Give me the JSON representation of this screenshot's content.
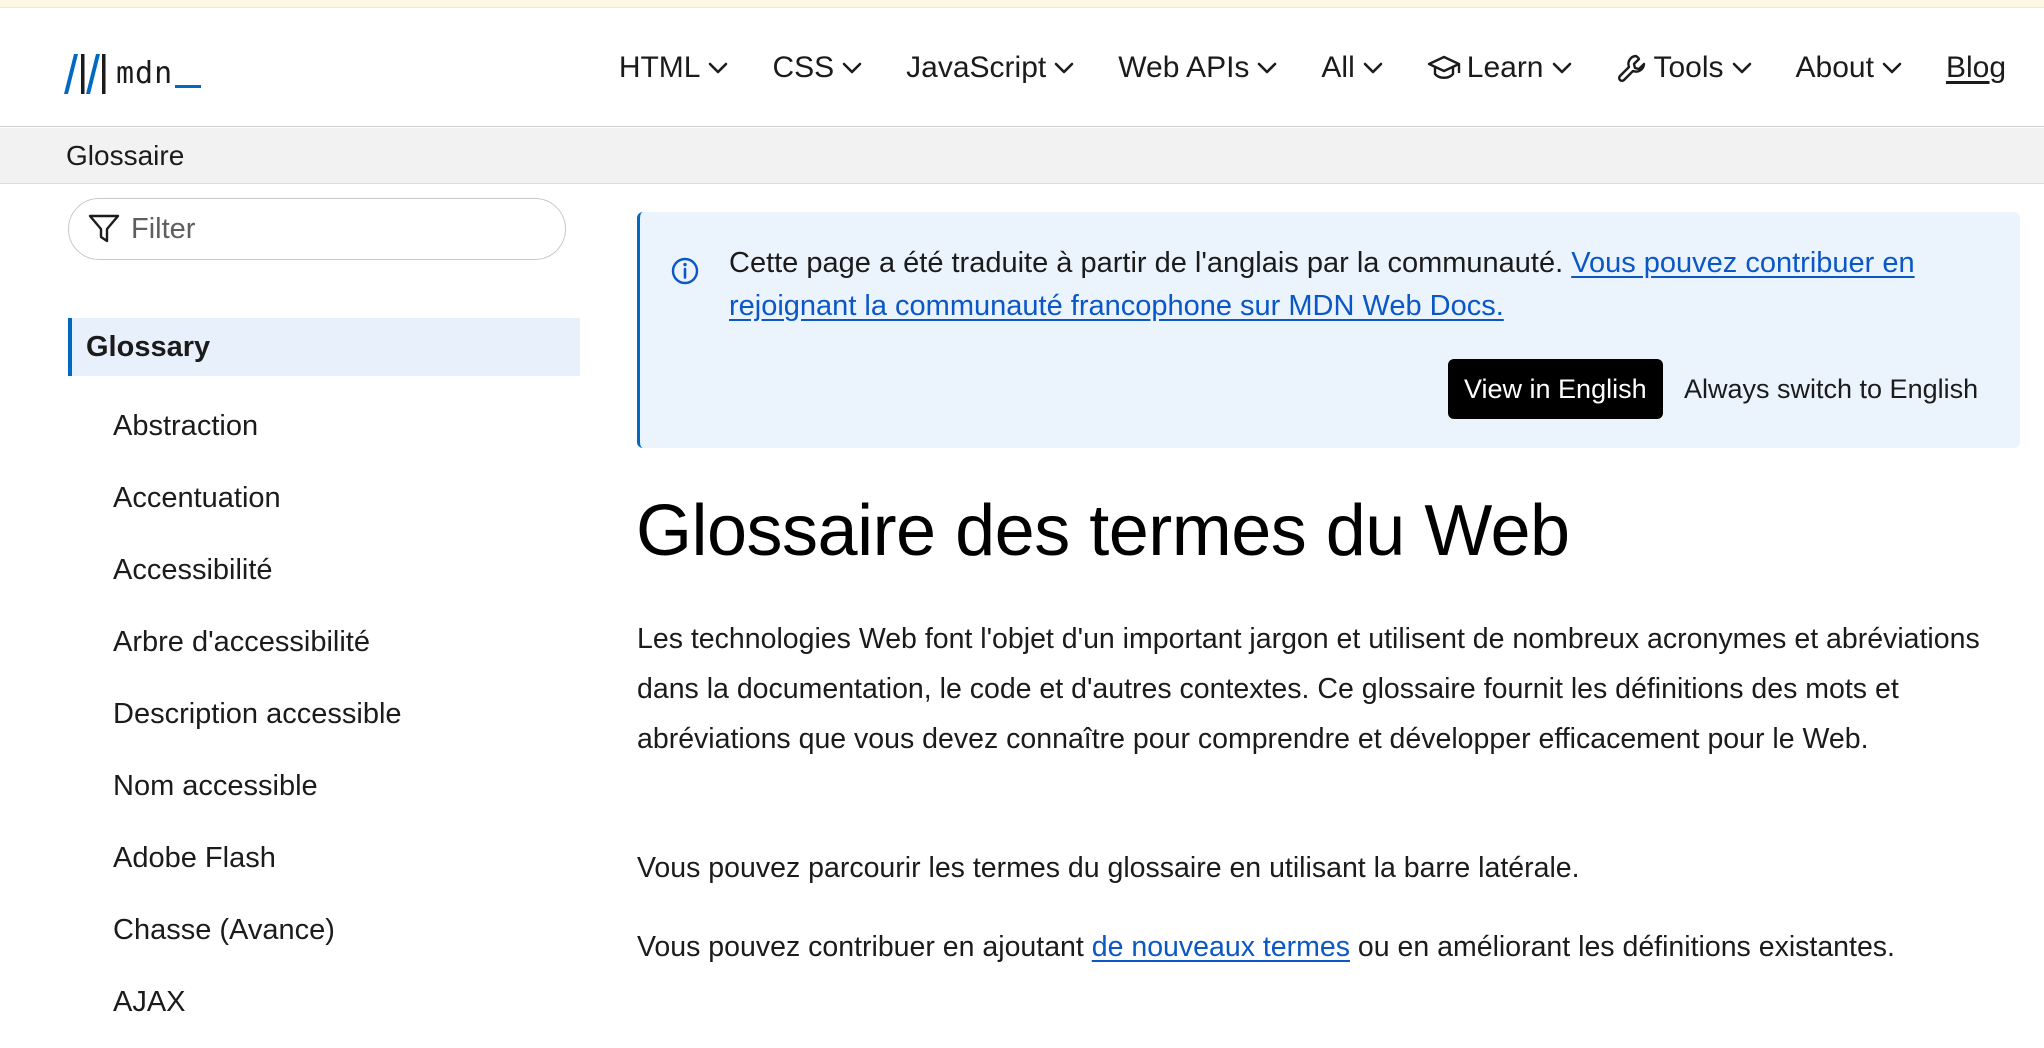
{
  "header": {
    "logo_text": "mdn",
    "nav": [
      {
        "label": "HTML",
        "icon": "chevron-down-icon"
      },
      {
        "label": "CSS",
        "icon": "chevron-down-icon"
      },
      {
        "label": "JavaScript",
        "icon": "chevron-down-icon"
      },
      {
        "label": "Web APIs",
        "icon": "chevron-down-icon"
      },
      {
        "label": "All",
        "icon": "chevron-down-icon"
      },
      {
        "label": "Learn",
        "icon": "graduation-cap-icon"
      },
      {
        "label": "Tools",
        "icon": "wrench-icon"
      },
      {
        "label": "About",
        "icon": "chevron-down-icon"
      },
      {
        "label": "Blog"
      }
    ]
  },
  "breadcrumb": {
    "label": "Glossaire"
  },
  "sidebar": {
    "filter_placeholder": "Filter",
    "active": "Glossary",
    "items": [
      "Abstraction",
      "Accentuation",
      "Accessibilité",
      "Arbre d'accessibilité",
      "Description accessible",
      "Nom accessible",
      "Adobe Flash",
      "Chasse (Avance)",
      "AJAX"
    ]
  },
  "notice": {
    "text": "Cette page a été traduite à partir de l'anglais par la communauté. ",
    "link": "Vous pouvez contribuer en rejoignant la communauté francophone sur MDN Web Docs.",
    "view_english": "View in English",
    "always_english": "Always switch to English"
  },
  "main": {
    "title": "Glossaire des termes du Web",
    "p1": "Les technologies Web font l'objet d'un important jargon et utilisent de nombreux acronymes et abréviations dans la documentation, le code et d'autres contextes. Ce glossaire fournit les définitions des mots et abréviations que vous devez connaître pour comprendre et développer efficacement pour le Web.",
    "p2": "Vous pouvez parcourir les termes du glossaire en utilisant la barre latérale.",
    "p3_before": "Vous pouvez contribuer en ajoutant ",
    "p3_link": "de nouveaux termes",
    "p3_after": " ou en améliorant les définitions existantes."
  },
  "colors": {
    "accent": "#0069c2",
    "link": "#0b57c5",
    "notice_bg": "#ebf3fd",
    "active_bg": "#e8f0fb"
  }
}
